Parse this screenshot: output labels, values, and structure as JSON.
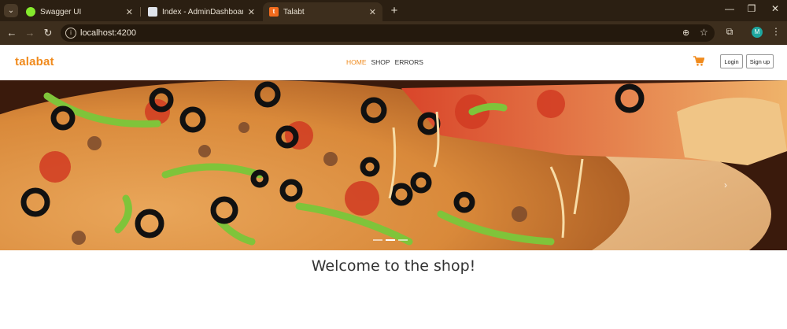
{
  "browser": {
    "tabs": [
      {
        "title": "Swagger UI",
        "favicon_color": "#85ea2d"
      },
      {
        "title": "Index - AdminDashboard",
        "favicon_color": "#dfe3ea"
      },
      {
        "title": "Talabt",
        "favicon_color": "#f26b1d",
        "favicon_letter": "t"
      }
    ],
    "new_tab_label": "+",
    "close_label": "✕",
    "url": "localhost:4200",
    "profile_initial": "M"
  },
  "navbar": {
    "brand": "talabat",
    "links": [
      "HOME",
      "SHOP",
      "ERRORS"
    ],
    "login_label": "Login",
    "signup_label": "Sign up",
    "accent_color": "#f08a1c"
  },
  "hero": {
    "next_arrow": "›",
    "slide_count": 3,
    "active_slide": 1
  },
  "main": {
    "welcome_text": "Welcome to the shop!"
  }
}
